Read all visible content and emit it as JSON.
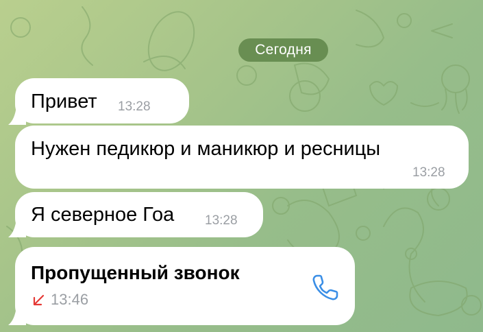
{
  "date_separator": "Сегодня",
  "messages": [
    {
      "text": "Привет",
      "time": "13:28"
    },
    {
      "text": "Нужен педикюр и маникюр и ресницы",
      "time": "13:28"
    },
    {
      "text": "Я северное Гоа",
      "time": "13:28"
    }
  ],
  "missed_call": {
    "title": "Пропущенный звонок",
    "time": "13:46",
    "status_icon": "missed-call-arrow-icon",
    "action_icon": "phone-icon"
  },
  "colors": {
    "bubble": "#ffffff",
    "date_pill": "#5c8246",
    "time_text": "#9a9ea3",
    "missed_red": "#e53935",
    "phone_blue": "#3a8ee6"
  }
}
